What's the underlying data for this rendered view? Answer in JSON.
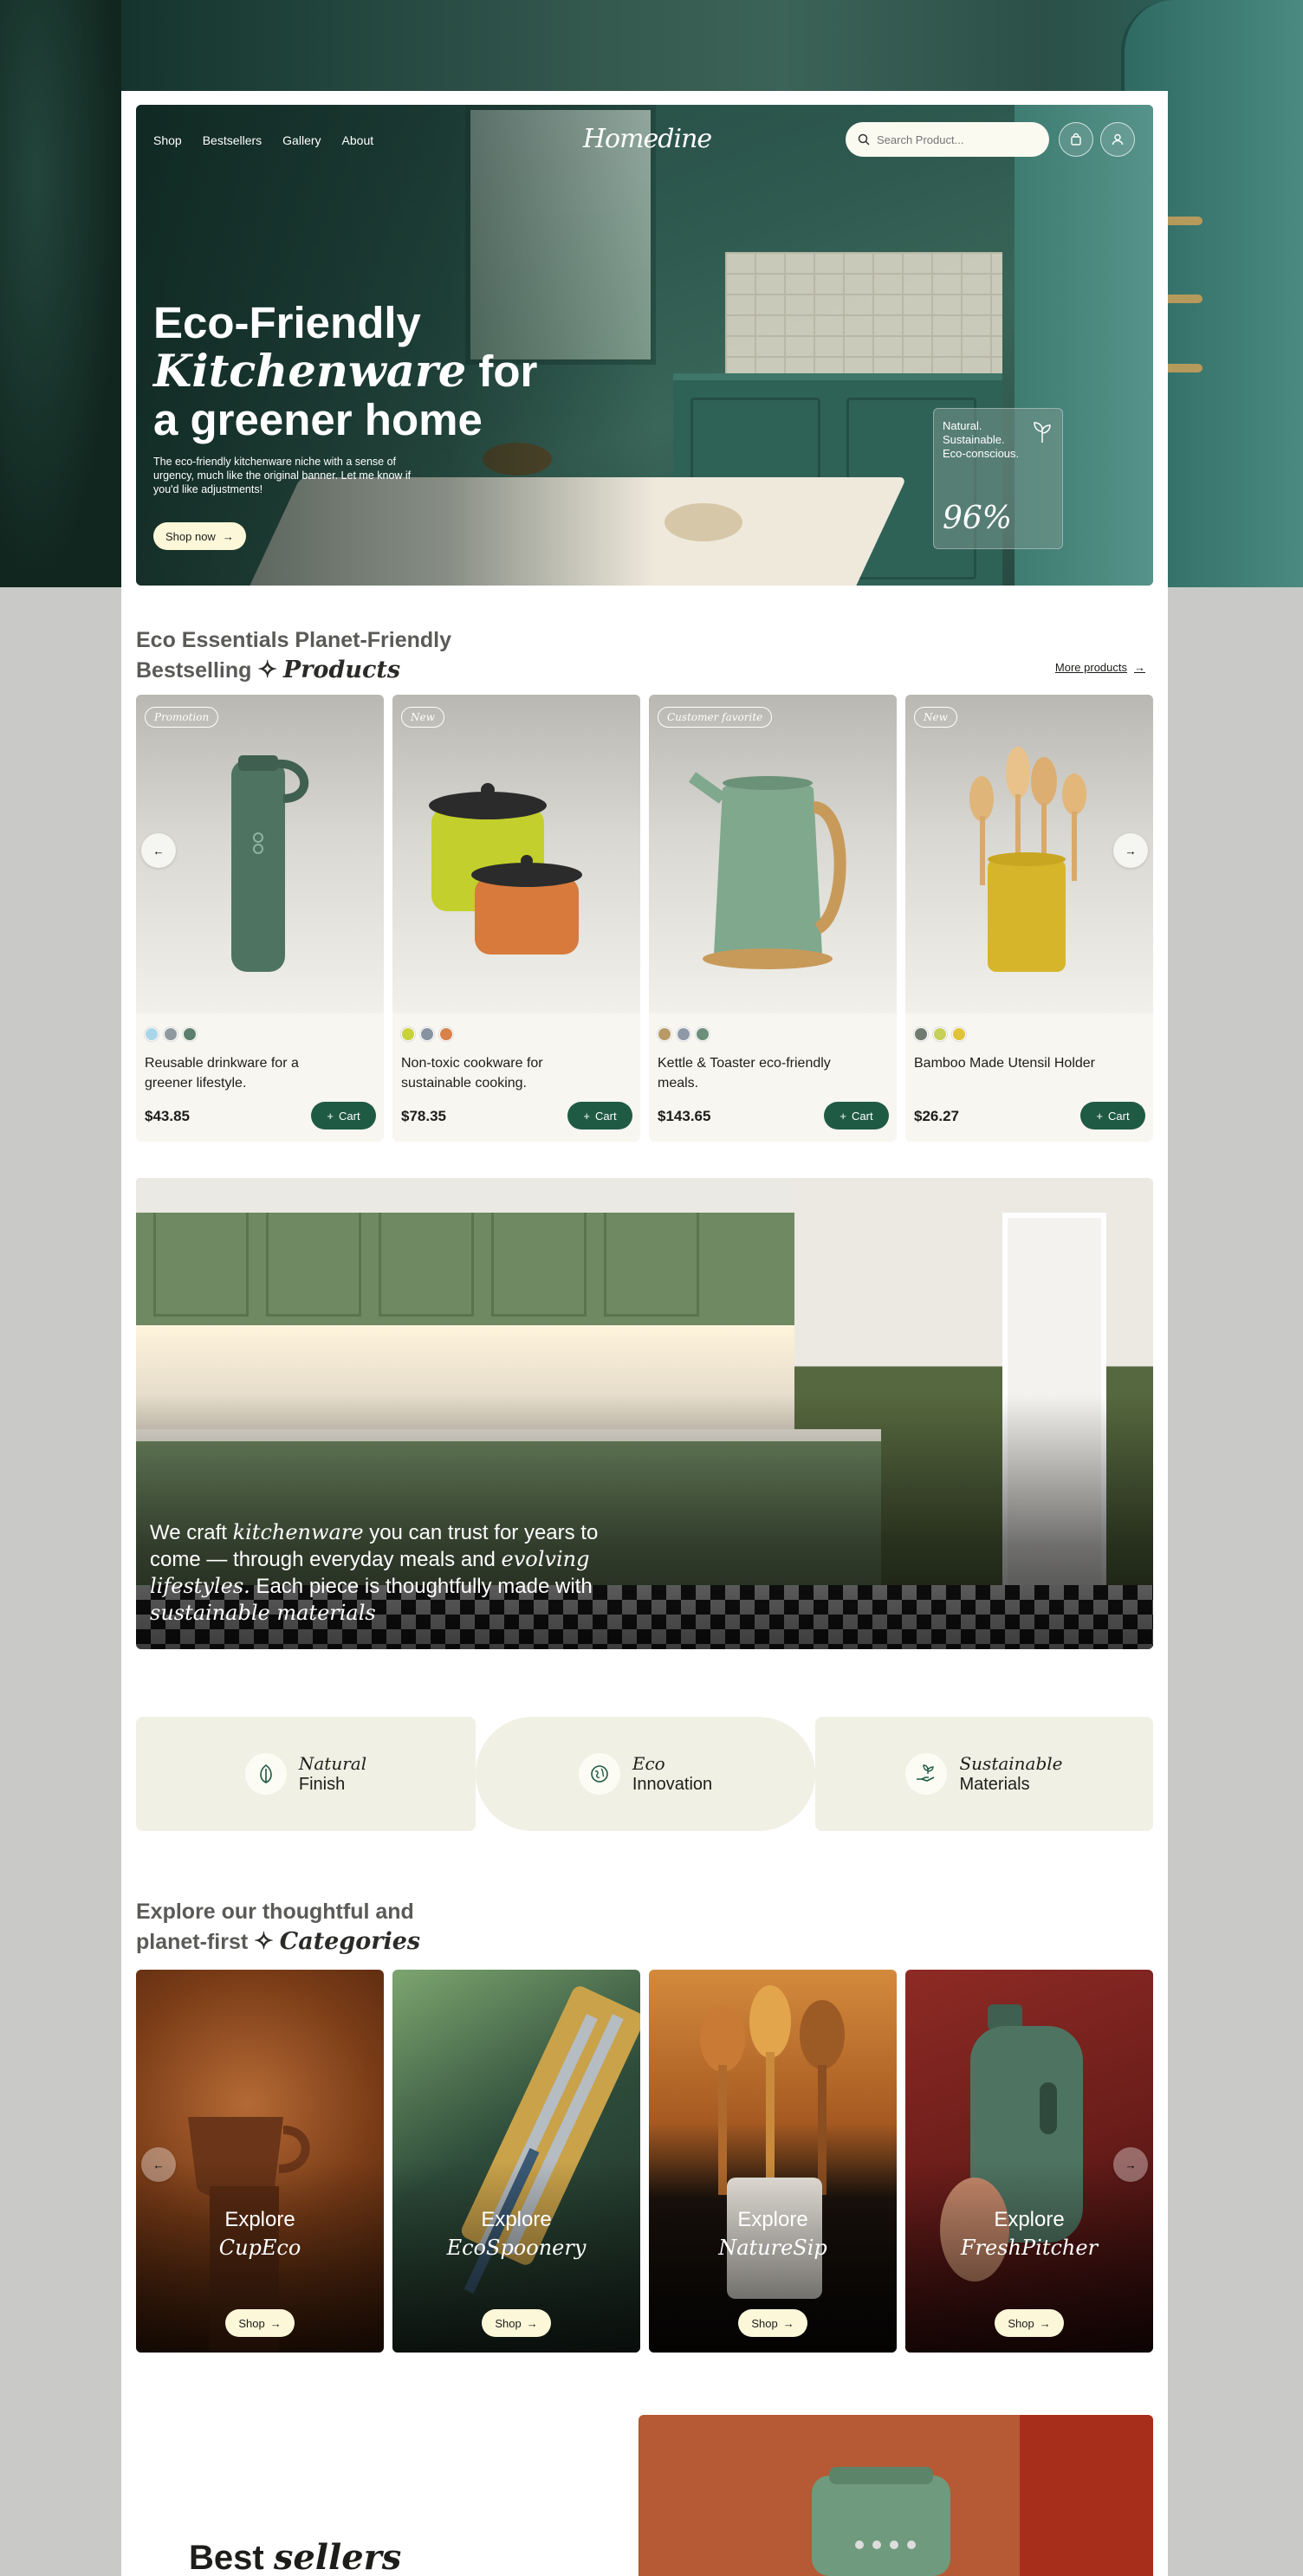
{
  "nav": [
    "Shop",
    "Bestsellers",
    "Gallery",
    "About"
  ],
  "logo": "Homedine",
  "search": {
    "placeholder": "Search Product..."
  },
  "hero": {
    "title_line1": "Eco-Friendly",
    "title_italic": "Kitchenware",
    "title_line2_rest": " for",
    "title_line3": "a greener home",
    "subtitle": "The eco-friendly kitchenware niche with a sense of urgency, much like the original banner. Let me know if you'd like adjustments!",
    "cta": "Shop now",
    "eco_card": {
      "line1": "Natural.",
      "line2": "Sustainable.",
      "line3": "Eco-conscious.",
      "percent": "96%"
    }
  },
  "bestselling": {
    "head_line1": "Eco Essentials Planet-Friendly",
    "head_line2_plain": "Bestselling",
    "head_sparkle": "✧",
    "head_italic": "Products",
    "more_link": "More products",
    "products": [
      {
        "tag": "Promotion",
        "desc": "Reusable drinkware for a greener lifestyle.",
        "price": "$43.85",
        "cart": "Cart",
        "swatches": [
          "#a9d6e8",
          "#8f9aa0",
          "#5d7f6b"
        ]
      },
      {
        "tag": "New",
        "desc": "Non-toxic cookware for sustainable cooking.",
        "price": "$78.35",
        "cart": "Cart",
        "swatches": [
          "#c8d23a",
          "#8793a0",
          "#d9824a"
        ]
      },
      {
        "tag": "Customer favorite",
        "desc": "Kettle & Toaster eco-friendly meals.",
        "price": "$143.65",
        "cart": "Cart",
        "swatches": [
          "#b89a66",
          "#8e98a6",
          "#6d8f79"
        ]
      },
      {
        "tag": "New",
        "desc": "Bamboo Made Utensil Holder",
        "price": "$26.27",
        "cart": "Cart",
        "swatches": [
          "#6f7a70",
          "#c6cf5a",
          "#e0c33a"
        ]
      }
    ]
  },
  "banner": {
    "t1": "We craft ",
    "t1_italic": "kitchenware",
    "t2": " you can trust for years to come — through everyday meals and ",
    "t2_italic": "evolving lifestyles.",
    "t3": " Each piece is thoughtfully made with ",
    "t3_italic": "sustainable materials"
  },
  "features": [
    {
      "italic": "Natural",
      "plain": "Finish",
      "icon": "leaf-icon"
    },
    {
      "italic": "Eco",
      "plain": "Innovation",
      "icon": "globe-leaf-icon"
    },
    {
      "italic": "Sustainable",
      "plain": "Materials",
      "icon": "hand-sprout-icon"
    }
  ],
  "categories": {
    "head_line1": "Explore our thoughtful and",
    "head_line2_plain": "planet-first",
    "head_sparkle": "✧",
    "head_italic": "Categories",
    "items": [
      {
        "explore": "Explore",
        "name": "CupEco",
        "shop": "Shop"
      },
      {
        "explore": "Explore",
        "name": "EcoSpoonery",
        "shop": "Shop"
      },
      {
        "explore": "Explore",
        "name": "NatureSip",
        "shop": "Shop"
      },
      {
        "explore": "Explore",
        "name": "FreshPitcher",
        "shop": "Shop"
      }
    ]
  },
  "best_sellers": {
    "plain": "Best",
    "italic": "sellers"
  },
  "colors": {
    "accent": "#1f5a45",
    "cream": "#fbf7d8",
    "panel": "#f0f0e4"
  }
}
